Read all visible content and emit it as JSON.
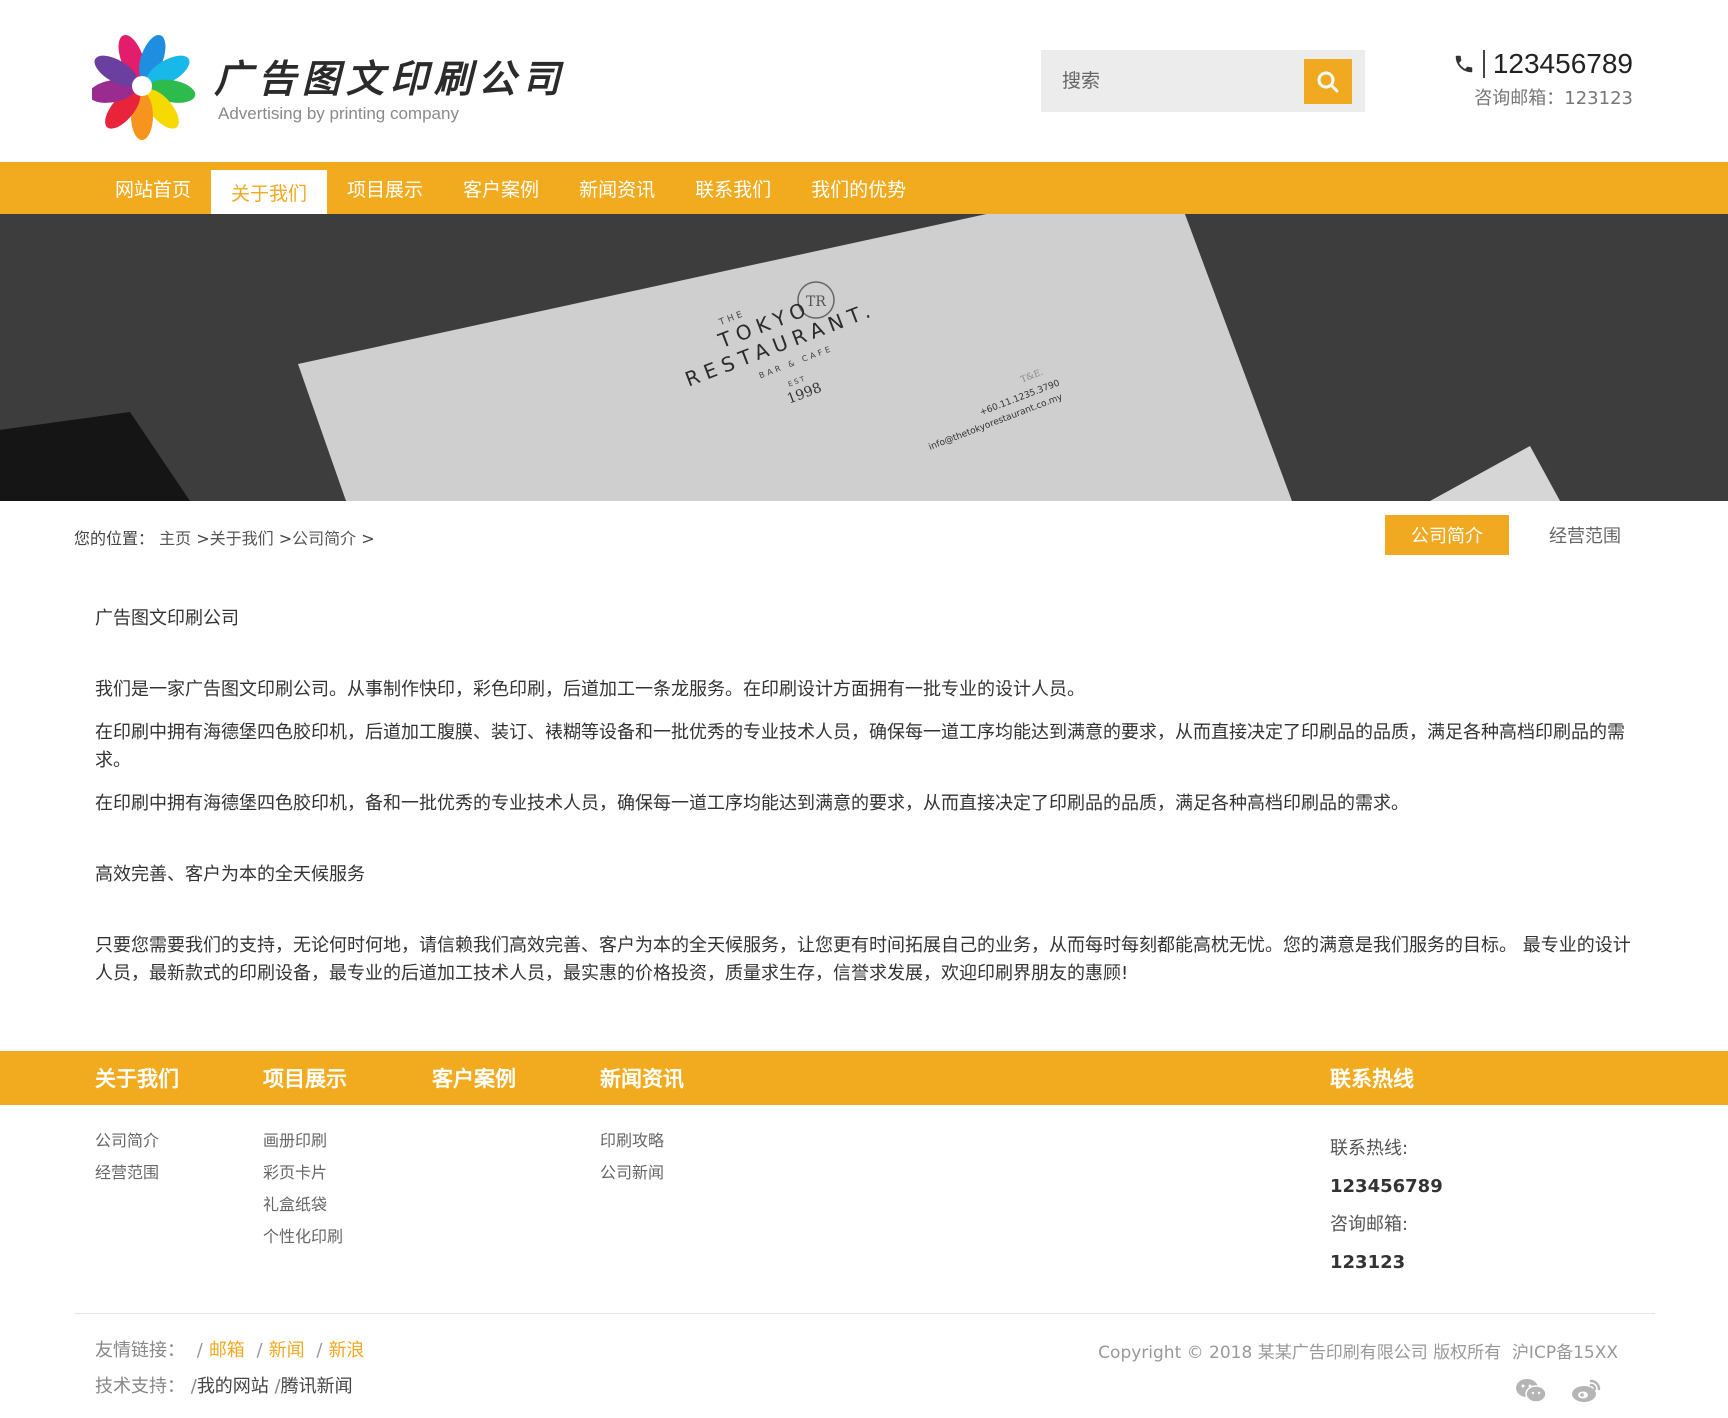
{
  "brand": {
    "name_cn": "广告图文印刷公司",
    "name_en": "Advertising by printing company",
    "accent_color": "#f2ab1f"
  },
  "search": {
    "placeholder": "搜索",
    "button_icon": "search-icon"
  },
  "contact_top": {
    "phone": "123456789",
    "email_label": "咨询邮箱：",
    "email": "123123"
  },
  "nav": {
    "items": [
      {
        "label": "网站首页"
      },
      {
        "label": "关于我们"
      },
      {
        "label": "项目展示"
      },
      {
        "label": "客户案例"
      },
      {
        "label": "新闻资讯"
      },
      {
        "label": "联系我们"
      },
      {
        "label": "我们的优势"
      }
    ],
    "active_index": 1
  },
  "banner": {
    "title_small": "THE",
    "title_line1": "TOKYO",
    "title_line2": "RESTAURANT.",
    "sub": "BAR & CAFE",
    "est": "EST",
    "year": "1998",
    "monogram": "TR",
    "contact_head": "T&E.",
    "contact_phone": "+60.11.1235.3790",
    "contact_mail": "info@thetokyorestaurant.co.my"
  },
  "breadcrumb": {
    "label": "您的位置：",
    "home": "主页",
    "sep": ">",
    "about": "关于我们",
    "current": "公司简介",
    "trail": ">"
  },
  "subnav": {
    "items": [
      {
        "label": "公司简介"
      },
      {
        "label": "经营范围"
      }
    ]
  },
  "content": {
    "heading1": "广告图文印刷公司",
    "p1": "我们是一家广告图文印刷公司。从事制作快印，彩色印刷，后道加工一条龙服务。在印刷设计方面拥有一批专业的设计人员。",
    "p2": "在印刷中拥有海德堡四色胶印机，后道加工腹膜、装订、裱糊等设备和一批优秀的专业技术人员，确保每一道工序均能达到满意的要求，从而直接决定了印刷品的品质，满足各种高档印刷品的需求。",
    "p3": "在印刷中拥有海德堡四色胶印机，备和一批优秀的专业技术人员，确保每一道工序均能达到满意的要求，从而直接决定了印刷品的品质，满足各种高档印刷品的需求。",
    "heading2": "高效完善、客户为本的全天候服务",
    "p4": "只要您需要我们的支持，无论何时何地，请信赖我们高效完善、客户为本的全天候服务，让您更有时间拓展自己的业务，从而每时每刻都能高枕无忧。您的满意是我们服务的目标。 最专业的设计人员，最新款式的印刷设备，最专业的后道加工技术人员，最实惠的价格投资，质量求生存，信誉求发展，欢迎印刷界朋友的惠顾!"
  },
  "footer": {
    "col_about": {
      "title": "关于我们",
      "links": [
        "公司简介",
        "经营范围"
      ]
    },
    "col_projects": {
      "title": "项目展示",
      "links": [
        "画册印刷",
        "彩页卡片",
        "礼盒纸袋",
        "个性化印刷"
      ]
    },
    "col_cases": {
      "title": "客户案例"
    },
    "col_news": {
      "title": "新闻资讯",
      "links": [
        "印刷攻略",
        "公司新闻"
      ]
    },
    "col_contact": {
      "title": "联系热线",
      "hotline_label": "联系热线:",
      "hotline": "123456789",
      "email_label": "咨询邮箱:",
      "email": "123123"
    },
    "friend_links": {
      "label": "友情链接：",
      "sep": "/",
      "items": [
        "邮箱",
        "新闻",
        "新浪"
      ]
    },
    "tech_support": {
      "label": "技术支持：",
      "sep": "/",
      "items": [
        "我的网站",
        "腾讯新闻"
      ]
    },
    "copyright": "Copyright © 2018 某某广告印刷有限公司 版权所有",
    "icp": "沪ICP备15XX",
    "social_icons": [
      "wechat-icon",
      "weibo-icon"
    ]
  }
}
